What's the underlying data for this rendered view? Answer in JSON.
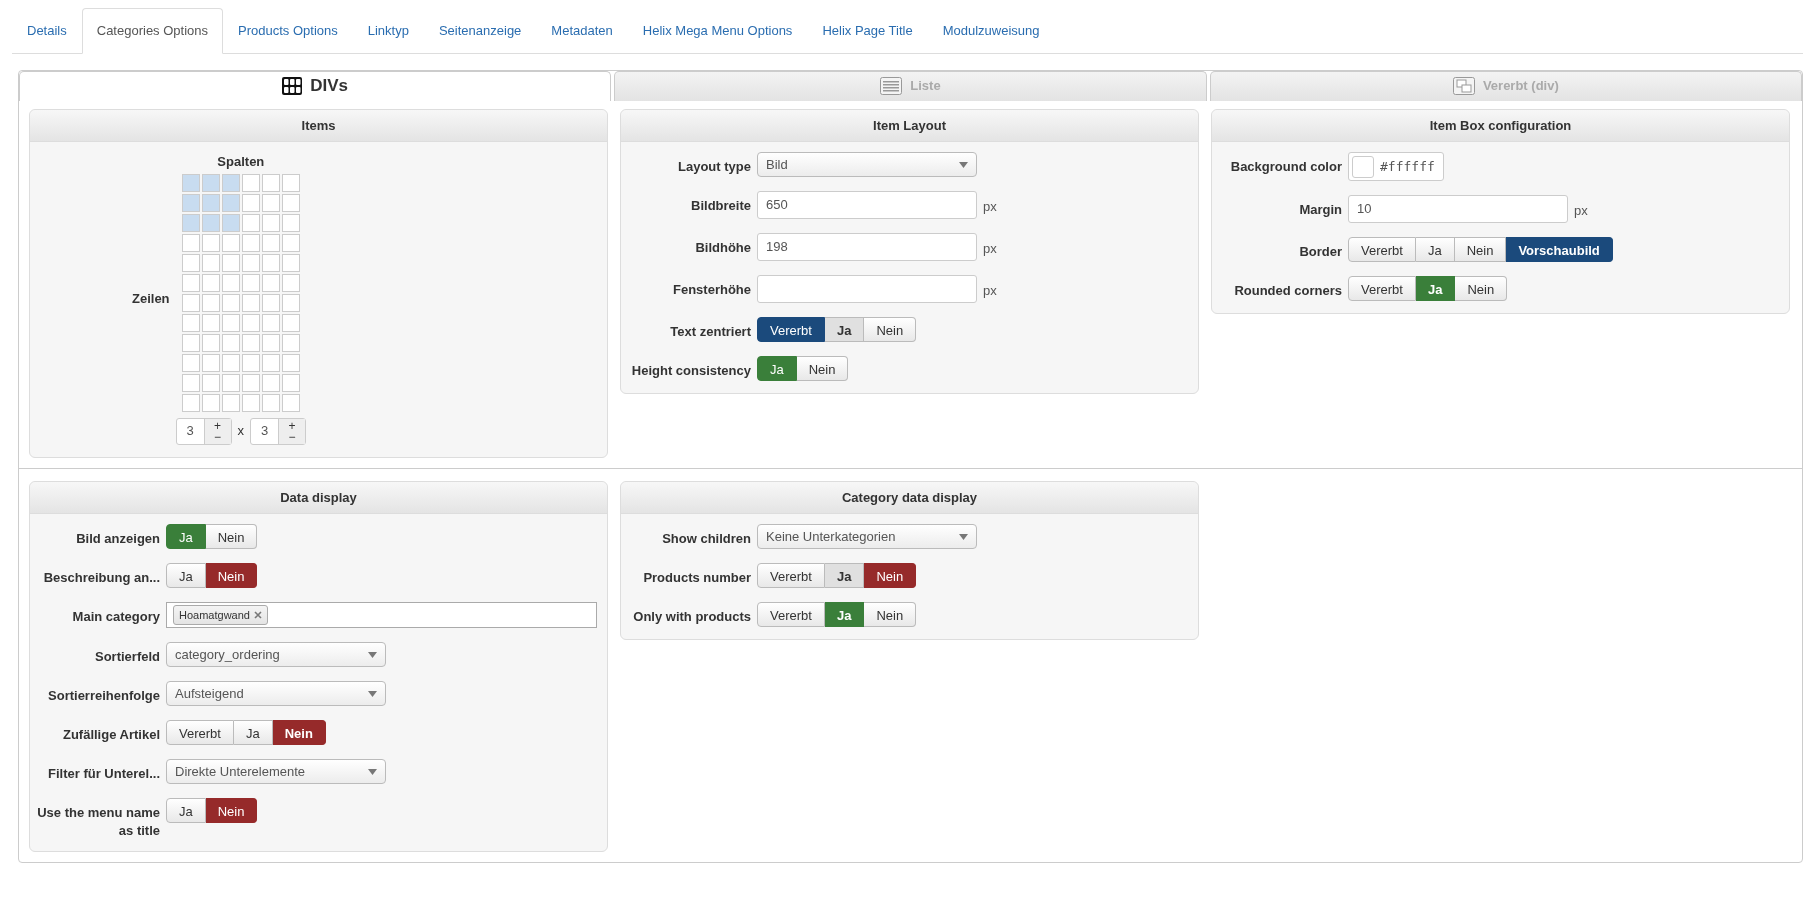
{
  "tabs": [
    {
      "label": "Details",
      "selected": false
    },
    {
      "label": "Categories Options",
      "selected": true
    },
    {
      "label": "Products Options",
      "selected": false
    },
    {
      "label": "Linktyp",
      "selected": false
    },
    {
      "label": "Seitenanzeige",
      "selected": false
    },
    {
      "label": "Metadaten",
      "selected": false
    },
    {
      "label": "Helix Mega Menu Options",
      "selected": false
    },
    {
      "label": "Helix Page Title",
      "selected": false
    },
    {
      "label": "Modulzuweisung",
      "selected": false
    }
  ],
  "view_tabs": [
    {
      "label": "DIVs",
      "kind": "divs",
      "selected": true
    },
    {
      "label": "Liste",
      "kind": "list",
      "selected": false
    },
    {
      "label": "Vererbt (div)",
      "kind": "inherit",
      "selected": false
    }
  ],
  "panel_rows": [
    {
      "panels": [
        {
          "title": "Items",
          "kind": "grid",
          "columns_label": "Spalten",
          "rows_label": "Zeilen",
          "cells": [
            [
              {
                "selected": true
              },
              {
                "selected": true
              },
              {
                "selected": true
              },
              {
                "selected": false
              },
              {
                "selected": false
              },
              {
                "selected": false
              }
            ],
            [
              {
                "selected": true
              },
              {
                "selected": true
              },
              {
                "selected": true
              },
              {
                "selected": false
              },
              {
                "selected": false
              },
              {
                "selected": false
              }
            ],
            [
              {
                "selected": true
              },
              {
                "selected": true
              },
              {
                "selected": true
              },
              {
                "selected": false
              },
              {
                "selected": false
              },
              {
                "selected": false
              }
            ],
            [
              {
                "selected": false
              },
              {
                "selected": false
              },
              {
                "selected": false
              },
              {
                "selected": false
              },
              {
                "selected": false
              },
              {
                "selected": false
              }
            ],
            [
              {
                "selected": false
              },
              {
                "selected": false
              },
              {
                "selected": false
              },
              {
                "selected": false
              },
              {
                "selected": false
              },
              {
                "selected": false
              }
            ],
            [
              {
                "selected": false
              },
              {
                "selected": false
              },
              {
                "selected": false
              },
              {
                "selected": false
              },
              {
                "selected": false
              },
              {
                "selected": false
              }
            ],
            [
              {
                "selected": false
              },
              {
                "selected": false
              },
              {
                "selected": false
              },
              {
                "selected": false
              },
              {
                "selected": false
              },
              {
                "selected": false
              }
            ],
            [
              {
                "selected": false
              },
              {
                "selected": false
              },
              {
                "selected": false
              },
              {
                "selected": false
              },
              {
                "selected": false
              },
              {
                "selected": false
              }
            ],
            [
              {
                "selected": false
              },
              {
                "selected": false
              },
              {
                "selected": false
              },
              {
                "selected": false
              },
              {
                "selected": false
              },
              {
                "selected": false
              }
            ],
            [
              {
                "selected": false
              },
              {
                "selected": false
              },
              {
                "selected": false
              },
              {
                "selected": false
              },
              {
                "selected": false
              },
              {
                "selected": false
              }
            ],
            [
              {
                "selected": false
              },
              {
                "selected": false
              },
              {
                "selected": false
              },
              {
                "selected": false
              },
              {
                "selected": false
              },
              {
                "selected": false
              }
            ],
            [
              {
                "selected": false
              },
              {
                "selected": false
              },
              {
                "selected": false
              },
              {
                "selected": false
              },
              {
                "selected": false
              },
              {
                "selected": false
              }
            ]
          ],
          "spinners": [
            {
              "value": "3",
              "plus": "+",
              "minus": "−"
            },
            {
              "value": "3",
              "plus": "+",
              "minus": "−"
            }
          ],
          "separator": "x"
        },
        {
          "title": "Item Layout",
          "kind": "form",
          "fields": [
            {
              "label": "Layout type",
              "kind": "select",
              "value": "Bild"
            },
            {
              "label": "Bildbreite",
              "kind": "text",
              "value": "650",
              "unit": "px"
            },
            {
              "label": "Bildhöhe",
              "kind": "text",
              "value": "198",
              "unit": "px"
            },
            {
              "label": "Fensterhöhe",
              "kind": "text",
              "unit": "px"
            },
            {
              "label": "Text zentriert",
              "kind": "toggle",
              "options": [
                {
                  "label": "Vererbt",
                  "selected": true,
                  "color": "#1b4a7c",
                  "bold": false
                },
                {
                  "label": "Ja",
                  "selected": false,
                  "bold": true
                },
                {
                  "label": "Nein",
                  "selected": false,
                  "bold": false
                }
              ]
            },
            {
              "label": "Height consistency",
              "kind": "toggle",
              "options": [
                {
                  "label": "Ja",
                  "selected": true,
                  "color": "#3a7f3a",
                  "bold": false
                },
                {
                  "label": "Nein",
                  "selected": false,
                  "bold": false
                }
              ]
            }
          ]
        },
        {
          "title": "Item Box configuration",
          "kind": "form",
          "fields": [
            {
              "label": "Background color",
              "kind": "color",
              "value": "#ffffff"
            },
            {
              "label": "Margin",
              "kind": "text",
              "value": "10",
              "unit": "px"
            },
            {
              "label": "Border",
              "kind": "toggle",
              "options": [
                {
                  "label": "Vererbt",
                  "selected": false,
                  "bold": false
                },
                {
                  "label": "Ja",
                  "selected": false,
                  "bold": false
                },
                {
                  "label": "Nein",
                  "selected": false,
                  "bold": false
                },
                {
                  "label": "Vorschaubild",
                  "selected": true,
                  "color": "#1b4a7c",
                  "bold": true
                }
              ]
            },
            {
              "label": "Rounded corners",
              "kind": "toggle",
              "options": [
                {
                  "label": "Vererbt",
                  "selected": false,
                  "bold": false
                },
                {
                  "label": "Ja",
                  "selected": true,
                  "color": "#3a7f3a",
                  "bold": true
                },
                {
                  "label": "Nein",
                  "selected": false,
                  "bold": false
                }
              ]
            }
          ]
        }
      ]
    },
    {
      "panels": [
        {
          "title": "Data display",
          "kind": "form",
          "fields": [
            {
              "label": "Bild anzeigen",
              "kind": "toggle",
              "options": [
                {
                  "label": "Ja",
                  "selected": true,
                  "color": "#3a7f3a",
                  "bold": false
                },
                {
                  "label": "Nein",
                  "selected": false,
                  "bold": false
                }
              ]
            },
            {
              "label": "Beschreibung an...",
              "kind": "toggle",
              "options": [
                {
                  "label": "Ja",
                  "selected": false,
                  "bold": false
                },
                {
                  "label": "Nein",
                  "selected": true,
                  "color": "#962a2a",
                  "bold": false
                }
              ]
            },
            {
              "label": "Main category",
              "kind": "tags",
              "tags": [
                "Hoamatgwand"
              ]
            },
            {
              "label": "Sortierfeld",
              "kind": "select",
              "value": "category_ordering"
            },
            {
              "label": "Sortierreihenfolge",
              "kind": "select",
              "value": "Aufsteigend"
            },
            {
              "label": "Zufällige Artikel",
              "kind": "toggle",
              "options": [
                {
                  "label": "Vererbt",
                  "selected": false,
                  "bold": false
                },
                {
                  "label": "Ja",
                  "selected": false,
                  "bold": false
                },
                {
                  "label": "Nein",
                  "selected": true,
                  "color": "#962a2a",
                  "bold": true
                }
              ]
            },
            {
              "label": "Filter für Unterel...",
              "kind": "select",
              "value": "Direkte Unterelemente"
            },
            {
              "label": "Use the menu name as title",
              "kind": "toggle",
              "options": [
                {
                  "label": "Ja",
                  "selected": false,
                  "bold": false
                },
                {
                  "label": "Nein",
                  "selected": true,
                  "color": "#962a2a",
                  "bold": false
                }
              ]
            }
          ]
        },
        {
          "title": "Category data display",
          "kind": "form",
          "fields": [
            {
              "label": "Show children",
              "kind": "select",
              "value": "Keine Unterkategorien"
            },
            {
              "label": "Products number",
              "kind": "toggle",
              "options": [
                {
                  "label": "Vererbt",
                  "selected": false,
                  "bold": false
                },
                {
                  "label": "Ja",
                  "selected": false,
                  "bold": true
                },
                {
                  "label": "Nein",
                  "selected": true,
                  "color": "#962a2a",
                  "bold": false
                }
              ]
            },
            {
              "label": "Only with products",
              "kind": "toggle",
              "options": [
                {
                  "label": "Vererbt",
                  "selected": false,
                  "bold": false
                },
                {
                  "label": "Ja",
                  "selected": true,
                  "color": "#3a7f3a",
                  "bold": true
                },
                {
                  "label": "Nein",
                  "selected": false,
                  "bold": false
                }
              ]
            }
          ]
        }
      ]
    }
  ]
}
